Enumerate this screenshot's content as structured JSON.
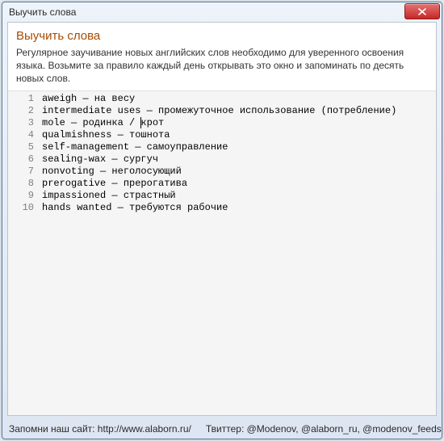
{
  "window": {
    "title": "Выучить слова"
  },
  "header": {
    "heading": "Выучить слова",
    "description": "Регулярное заучивание новых английских слов необходимо для уверенного освоения языка. Возьмите за правило каждый день открывать это окно и запоминать по десять новых слов."
  },
  "editor": {
    "lines": [
      "aweigh — на весу",
      "intermediate uses — промежуточное использование (потребление)",
      "mole — родинка / крот",
      "qualmishness — тошнота",
      "self-management — самоуправление",
      "sealing-wax — сургуч",
      "nonvoting — неголосующий",
      "prerogative — прерогатива",
      "impassioned — страстный",
      "hands wanted — требуются рабочие"
    ],
    "caret": {
      "line": 3,
      "col": 18
    }
  },
  "status": {
    "left": "Запомни наш сайт: http://www.alaborn.ru/",
    "right": "Твиттер: @Modenov, @alaborn_ru, @modenov_feeds"
  }
}
